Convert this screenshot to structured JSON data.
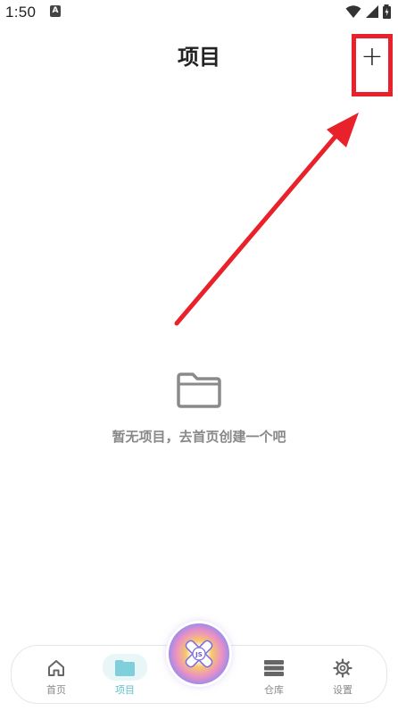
{
  "status_bar": {
    "time": "1:50",
    "notification_icon": "A"
  },
  "header": {
    "title": "项目",
    "add_label": "+"
  },
  "empty_state": {
    "message": "暂无项目，去首页创建一个吧",
    "icon": "folder-icon"
  },
  "bottom_nav": {
    "items": [
      {
        "label": "首页",
        "icon": "home-icon",
        "active": false
      },
      {
        "label": "项目",
        "icon": "folder-icon",
        "active": true
      },
      {
        "label": "仓库",
        "icon": "storage-icon",
        "active": false
      },
      {
        "label": "设置",
        "icon": "gear-icon",
        "active": false
      }
    ],
    "center_button": {
      "icon": "app-logo-icon",
      "text": "JS"
    }
  },
  "colors": {
    "annotation_red": "#e8212a",
    "accent": "#5fbfd0",
    "muted_text": "#888888"
  }
}
